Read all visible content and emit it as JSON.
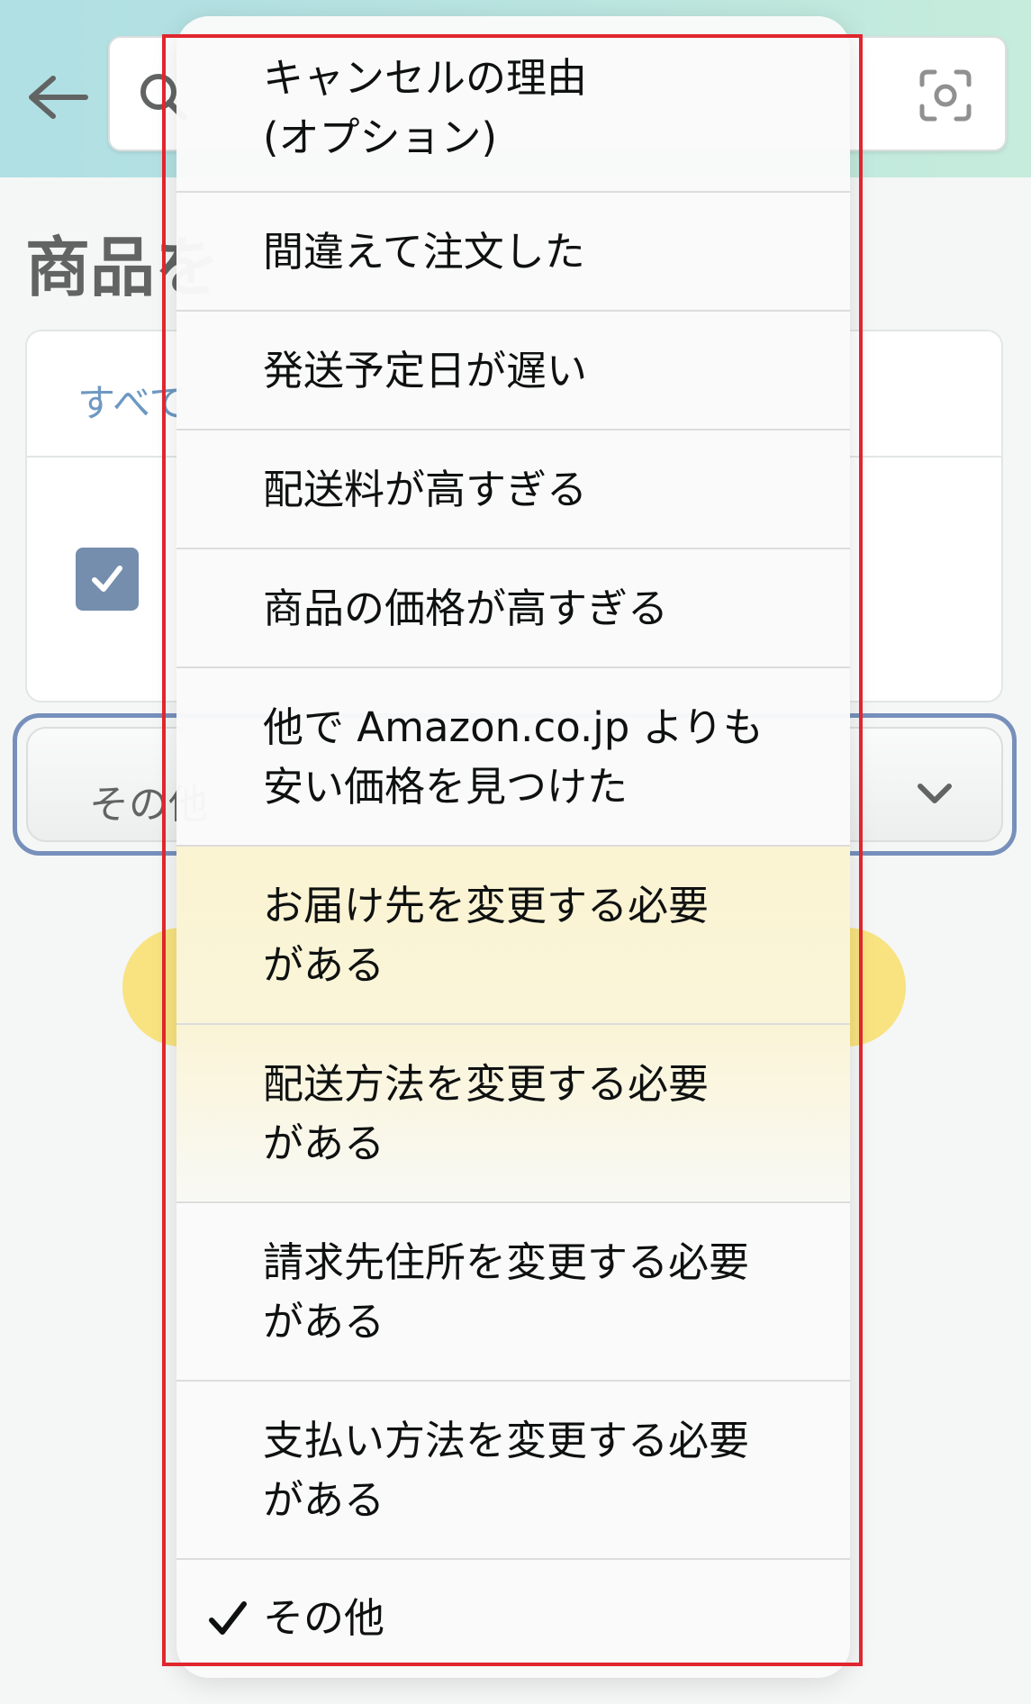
{
  "header": {
    "back_icon": "back-arrow-icon",
    "search_icon": "search-icon",
    "camera_icon": "camera-scan-icon",
    "gradient_colors": [
      "#86cfd6",
      "#a8e2c9"
    ]
  },
  "page": {
    "heading": "商品を",
    "select_all_link": "すべて",
    "reason_select_value": "その他",
    "accent_color": "#2f5597",
    "button_color": "#f7ca00"
  },
  "dropdown": {
    "title": "キャンセルの理由\n(オプション)",
    "items": [
      {
        "label": "間違えて注文した",
        "selected": false
      },
      {
        "label": "発送予定日が遅い",
        "selected": false
      },
      {
        "label": "配送料が高すぎる",
        "selected": false
      },
      {
        "label": "商品の価格が高すぎる",
        "selected": false
      },
      {
        "label": "他で Amazon.co.jp よりも\n安い価格を見つけた",
        "selected": false
      },
      {
        "label": "お届け先を変更する必要\nがある",
        "selected": false
      },
      {
        "label": "配送方法を変更する必要\nがある",
        "selected": false
      },
      {
        "label": "請求先住所を変更する必要\nがある",
        "selected": false
      },
      {
        "label": "支払い方法を変更する必要\nがある",
        "selected": false
      },
      {
        "label": "その他",
        "selected": true
      }
    ],
    "selected_marker_icon": "checkmark-icon",
    "annotation_color": "#e0262e"
  }
}
